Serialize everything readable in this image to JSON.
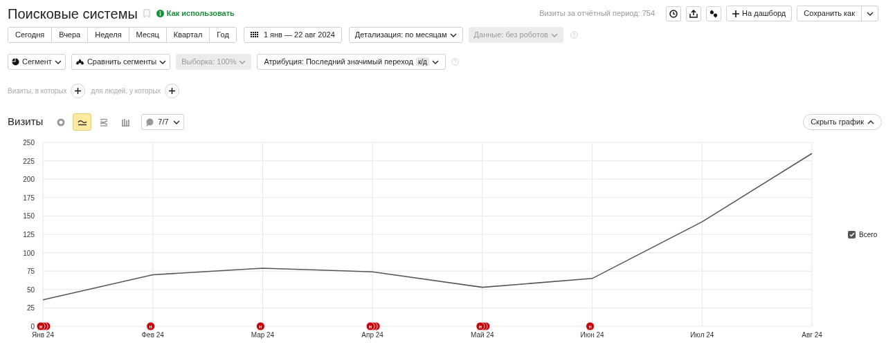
{
  "header": {
    "title": "Поисковые системы",
    "help_link": "Как использовать",
    "visits_total": "Визиты за отчётный период: 754",
    "dashboard_button": "На дашборд",
    "save_button": "Сохранить как"
  },
  "periods": [
    {
      "label": "Сегодня",
      "selected": false
    },
    {
      "label": "Вчера",
      "selected": false
    },
    {
      "label": "Неделя",
      "selected": false
    },
    {
      "label": "Месяц",
      "selected": false
    },
    {
      "label": "Квартал",
      "selected": false
    },
    {
      "label": "Год",
      "selected": false
    }
  ],
  "date_range": "1 янв — 22 авг 2024",
  "detail": "Детализация: по месяцам",
  "data_filter": {
    "label": "Данные: без роботов",
    "disabled": true
  },
  "segment": "Сегмент",
  "compare": "Сравнить сегменты",
  "sample": {
    "label": "Выборка: 100%",
    "disabled": true
  },
  "attribution": {
    "label": "Атрибуция: Последний значимый переход",
    "badge": "к/д"
  },
  "filters": [
    "Визиты, в которых",
    "для людей, у которых"
  ],
  "chart_section": {
    "title": "Визиты",
    "chart_types": [
      {
        "kind": "pie",
        "selected": false
      },
      {
        "kind": "line",
        "selected": true
      },
      {
        "kind": "area",
        "selected": false
      },
      {
        "kind": "bar",
        "selected": false
      }
    ],
    "annotations_toggle": "7/7",
    "hide_button": "Скрыть график",
    "legend": [
      {
        "checked": true
      }
    ],
    "markers": [
      {
        "label": "н",
        "stacked": true
      },
      {
        "label": "н",
        "stacked": false
      },
      {
        "label": "н",
        "stacked": false
      },
      {
        "label": "н",
        "stacked": true
      },
      {
        "label": "н",
        "stacked": true
      },
      {
        "label": "н",
        "stacked": false
      }
    ],
    "chart_data": {
      "type": "line",
      "categories": [
        "Янв 24",
        "Фев 24",
        "Мар 24",
        "Апр 24",
        "Май 24",
        "Июн 24",
        "Июл 24",
        "Авг 24"
      ],
      "series": [
        {
          "name": "Всего",
          "color": "#555555",
          "values": [
            36,
            70,
            79,
            74,
            53,
            65,
            142,
            235
          ]
        }
      ],
      "ylim": [
        0,
        250
      ],
      "yticks": [
        0,
        25,
        50,
        75,
        100,
        125,
        150,
        175,
        200,
        225,
        250
      ],
      "grid": true
    }
  }
}
